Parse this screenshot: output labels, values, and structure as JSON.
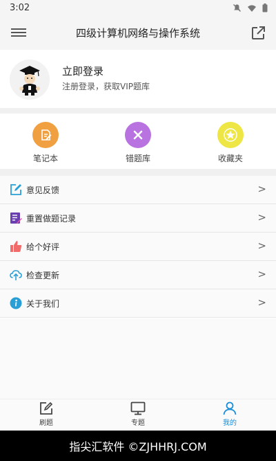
{
  "status_bar": {
    "time": "3:02"
  },
  "app_bar": {
    "title": "四级计算机网络与操作系统"
  },
  "profile": {
    "title": "立即登录",
    "subtitle": "注册登录，获取VIP题库"
  },
  "quick_actions": [
    {
      "label": "笔记本",
      "icon": "notebook-icon",
      "color": "#F0A040"
    },
    {
      "label": "错题库",
      "icon": "close-icon",
      "color": "#B873E0"
    },
    {
      "label": "收藏夹",
      "icon": "star-icon",
      "color": "#EEE645"
    }
  ],
  "menu_items": [
    {
      "label": "意见反馈",
      "icon": "edit-icon",
      "arrow": ">"
    },
    {
      "label": "重置做题记录",
      "icon": "reset-record-icon",
      "arrow": ">"
    },
    {
      "label": "给个好评",
      "icon": "thumbs-up-icon",
      "arrow": ">"
    },
    {
      "label": "检查更新",
      "icon": "cloud-upload-icon",
      "arrow": ">"
    },
    {
      "label": "关于我们",
      "icon": "info-icon",
      "arrow": ">"
    }
  ],
  "tab_bar": [
    {
      "label": "刷题",
      "icon": "pencil-square-icon"
    },
    {
      "label": "专题",
      "icon": "monitor-icon"
    },
    {
      "label": "我的",
      "icon": "user-icon",
      "active": true
    }
  ],
  "watermark": {
    "text": "指尖汇软件 ©ZJHHRJ.COM"
  },
  "colors": {
    "accent": "#1A8FD8",
    "background": "#F5F5F5"
  }
}
